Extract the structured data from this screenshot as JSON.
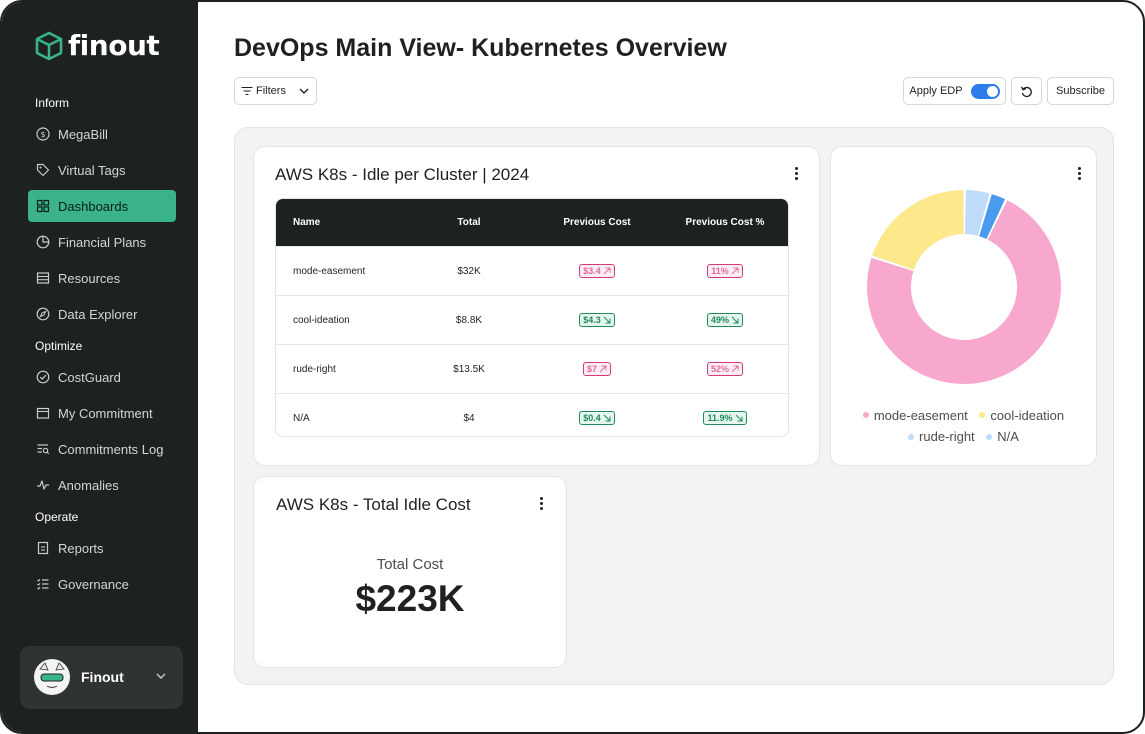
{
  "brand": {
    "name": "finout"
  },
  "sidebar": {
    "sections": [
      {
        "label": "Inform"
      },
      {
        "label": "Optimize"
      },
      {
        "label": "Operate"
      }
    ],
    "items": [
      {
        "label": "MegaBill",
        "icon": "dollar-circle-icon"
      },
      {
        "label": "Virtual Tags",
        "icon": "tag-icon"
      },
      {
        "label": "Dashboards",
        "icon": "grid-icon",
        "active": true
      },
      {
        "label": "Financial Plans",
        "icon": "pie-icon"
      },
      {
        "label": "Resources",
        "icon": "server-icon"
      },
      {
        "label": "Data Explorer",
        "icon": "compass-icon"
      },
      {
        "label": "CostGuard",
        "icon": "check-circle-icon"
      },
      {
        "label": "My Commitment",
        "icon": "calendar-icon"
      },
      {
        "label": "Commitments Log",
        "icon": "list-search-icon"
      },
      {
        "label": "Anomalies",
        "icon": "pulse-icon"
      },
      {
        "label": "Reports",
        "icon": "document-icon"
      },
      {
        "label": "Governance",
        "icon": "checklist-icon"
      }
    ],
    "user": {
      "name": "Finout"
    }
  },
  "header": {
    "title": "DevOps Main View- Kubernetes Overview",
    "filters_label": "Filters",
    "apply_edp_label": "Apply EDP",
    "apply_edp_on": true,
    "subscribe_label": "Subscribe"
  },
  "idle_table_card": {
    "title": "AWS K8s - Idle per Cluster | 2024",
    "columns": [
      "Name",
      "Total",
      "Previous Cost",
      "Previous Cost %"
    ],
    "rows": [
      {
        "name": "mode-easement",
        "total": "$32K",
        "prev_cost": "$3.4",
        "prev_cost_dir": "up",
        "prev_pct": "11%",
        "prev_pct_dir": "up"
      },
      {
        "name": "cool-ideation",
        "total": "$8.8K",
        "prev_cost": "$4.3",
        "prev_cost_dir": "down",
        "prev_pct": "49%",
        "prev_pct_dir": "down"
      },
      {
        "name": "rude-right",
        "total": "$13.5K",
        "prev_cost": "$7",
        "prev_cost_dir": "up",
        "prev_pct": "52%",
        "prev_pct_dir": "up"
      },
      {
        "name": "N/A",
        "total": "$4",
        "prev_cost": "$0.4",
        "prev_cost_dir": "down",
        "prev_pct": "11.9%",
        "prev_pct_dir": "down"
      }
    ]
  },
  "chart_data": {
    "type": "pie",
    "series": [
      {
        "name": "mode-easement",
        "value": 32,
        "color": "#f7a8cc"
      },
      {
        "name": "cool-ideation",
        "value": 8.8,
        "color": "#fde98c"
      },
      {
        "name": "rude-right",
        "value": 1.9,
        "color": "#bfdcfb"
      },
      {
        "name": "N/A",
        "value": 1.2,
        "color": "#4a9bf0"
      }
    ],
    "legend_position": "bottom"
  },
  "total_card": {
    "title": "AWS K8s - Total Idle Cost",
    "label": "Total Cost",
    "value": "$223K"
  }
}
